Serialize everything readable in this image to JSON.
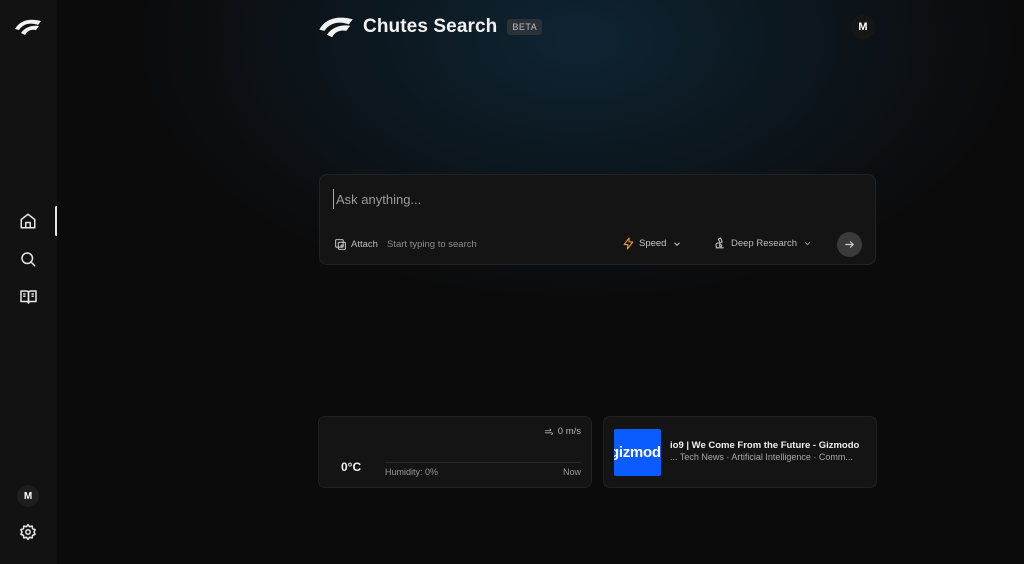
{
  "app": {
    "title": "Chutes Search",
    "badge": "BETA",
    "user_initial": "M"
  },
  "sidebar": {
    "items": [
      {
        "name": "home",
        "icon": "home-icon",
        "active": true
      },
      {
        "name": "search",
        "icon": "search-icon"
      },
      {
        "name": "library",
        "icon": "book-open-icon"
      }
    ],
    "user_initial": "M",
    "settings_icon": "gear-icon"
  },
  "search": {
    "placeholder": "Ask anything...",
    "attach_label": "Attach",
    "hint": "Start typing to search",
    "mode_label": "Speed",
    "research_label": "Deep Research",
    "accent": "#f0a030"
  },
  "weather": {
    "wind": "0 m/s",
    "temperature": "0°C",
    "humidity": "Humidity: 0%",
    "time": "Now"
  },
  "news": {
    "thumb_text": "gizmodo",
    "thumb_color": "#0a5cff",
    "title": "io9 | We Come From the Future - Gizmodo",
    "tags": "... Tech News · Artificial Intelligence · Comm..."
  }
}
